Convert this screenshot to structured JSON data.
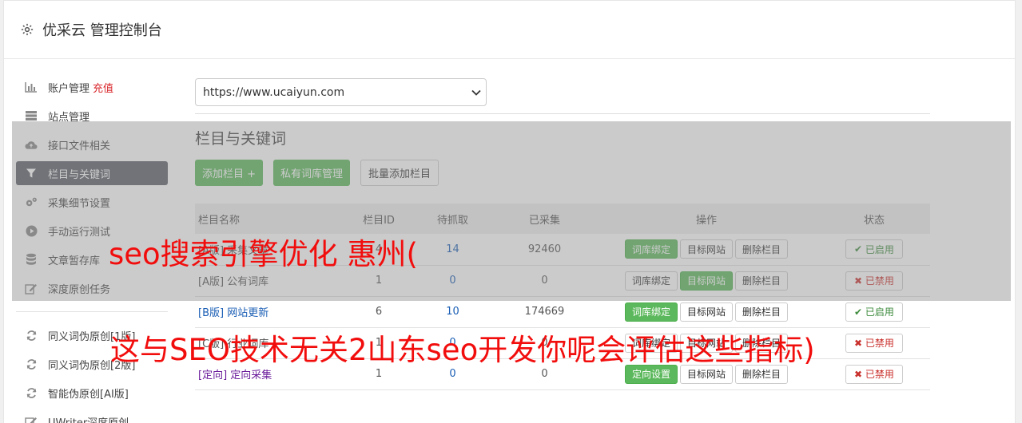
{
  "header": {
    "title": "优采云 管理控制台",
    "icon": "gear-icon"
  },
  "sidebar": {
    "items": [
      {
        "label": "账户管理",
        "extra": "充值",
        "icon": "bar-chart-icon"
      },
      {
        "label": "站点管理",
        "icon": "server-icon"
      },
      {
        "label": "接口文件相关",
        "icon": "cloud-upload-icon"
      },
      {
        "label": "栏目与关键词",
        "icon": "filter-icon"
      },
      {
        "label": "采集细节设置",
        "icon": "cogs-icon"
      },
      {
        "label": "手动运行测试",
        "icon": "play-icon"
      },
      {
        "label": "文章暂存库",
        "icon": "database-icon"
      },
      {
        "label": "深度原创任务",
        "icon": "edit-icon"
      }
    ],
    "items2": [
      {
        "label": "同义词伪原创[1版]",
        "icon": "refresh-icon"
      },
      {
        "label": "同义词伪原创[2版]",
        "icon": "refresh-icon"
      },
      {
        "label": "智能伪原创[AI版]",
        "icon": "refresh-icon"
      },
      {
        "label": "UWriter深度原创",
        "icon": "edit-icon"
      }
    ]
  },
  "main": {
    "site_select": "https://www.ucaiyun.com",
    "section_title": "栏目与关键词",
    "buttons": {
      "add": "添加栏目 +",
      "private": "私有词库管理",
      "batch": "批量添加栏目"
    }
  },
  "table": {
    "headers": [
      "栏目名称",
      "栏目ID",
      "待抓取",
      "已采集",
      "操作",
      "状态"
    ],
    "rows": [
      {
        "name": "[A版] 采集文章",
        "id": "4",
        "pending": "14",
        "collected": "92460",
        "op1": "词库绑定",
        "op2": "目标网站",
        "op3": "删除栏目",
        "status": "已启用"
      },
      {
        "name": "[A版] 公有词库",
        "id": "1",
        "pending": "0",
        "collected": "0",
        "op1": "词库绑定",
        "op2": "目标网站",
        "op3": "删除栏目",
        "status": "已禁用"
      },
      {
        "name": "[B版] 网站更新",
        "id": "6",
        "pending": "10",
        "collected": "174669",
        "op1": "词库绑定",
        "op2": "目标网站",
        "op3": "删除栏目",
        "status": "已启用"
      },
      {
        "name": "[C版] 行业词库",
        "id": "1",
        "pending": "0",
        "collected": "0",
        "op1": "词库绑定",
        "op2": "目标网站",
        "op3": "删除栏目",
        "status": "已禁用"
      },
      {
        "name": "[定向] 定向采集",
        "id": "1",
        "pending": "0",
        "collected": "0",
        "op1": "定向设置",
        "op2": "目标网站",
        "op3": "删除栏目",
        "status": "已禁用"
      }
    ]
  },
  "watermark": {
    "line1": "seo搜索引擎优化 惠州(",
    "line2": "这与SEO技术无关2山东seo开发你呢会评估这些指标)"
  },
  "colors": {
    "green": "#5cb85c",
    "active_nav": "#5b6069",
    "watermark": "#f20d0d"
  }
}
